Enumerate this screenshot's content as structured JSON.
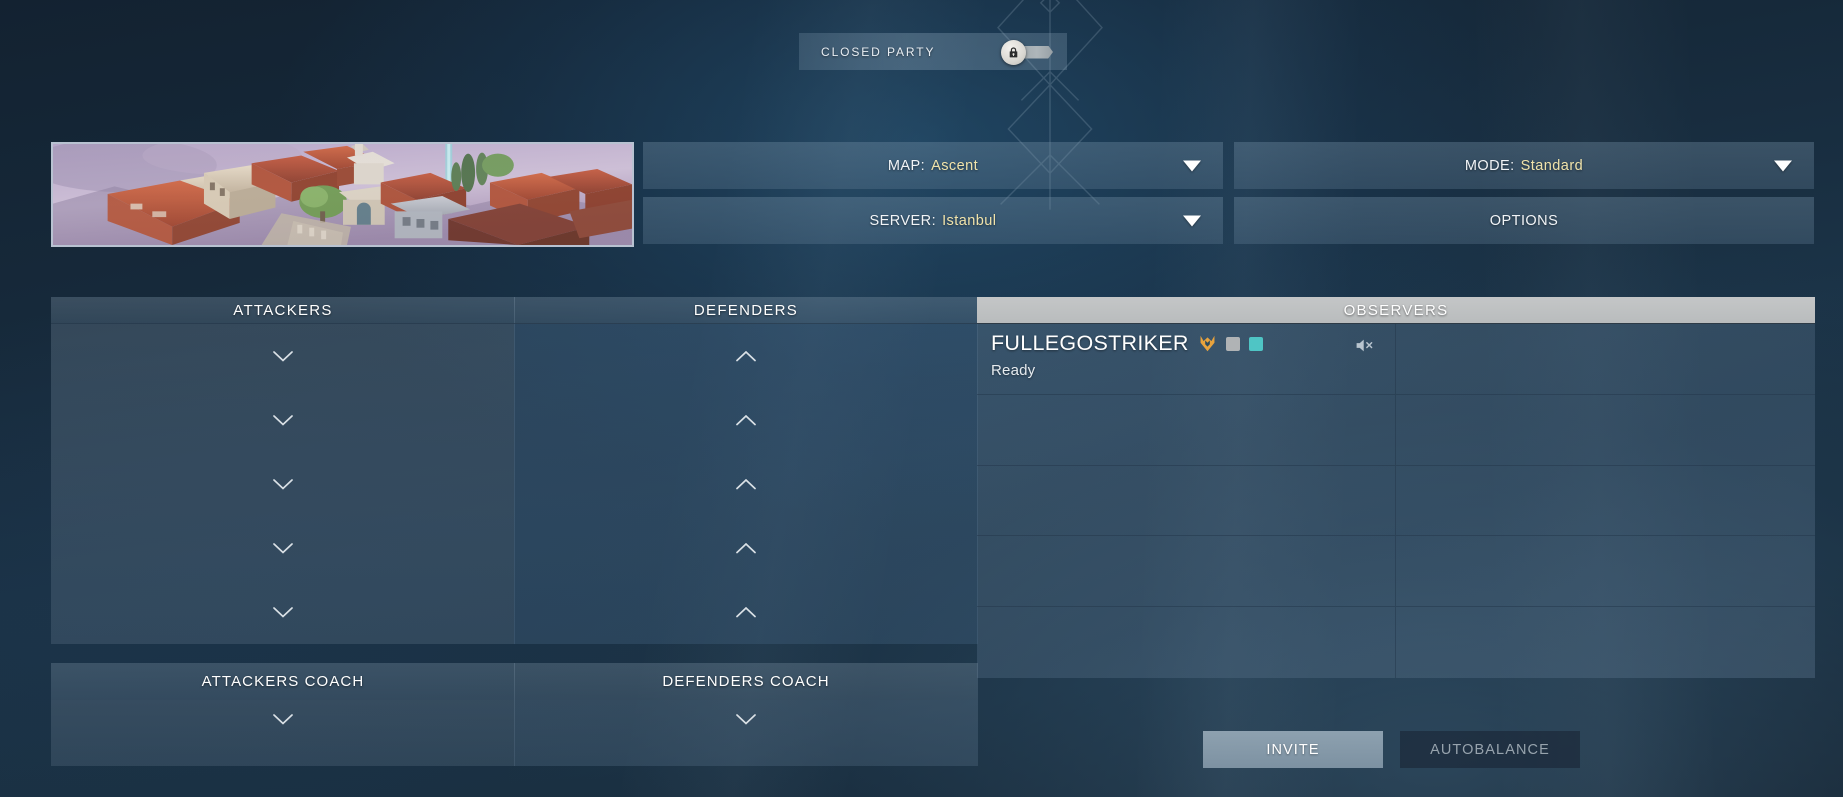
{
  "party": {
    "label": "CLOSED PARTY",
    "toggle_state": "closed",
    "lock_icon": "lock-icon"
  },
  "selectors": {
    "map": {
      "label": "MAP:",
      "value": "Ascent",
      "caret_icon": "caret-down-icon"
    },
    "server": {
      "label": "SERVER:",
      "value": "Istanbul",
      "caret_icon": "caret-down-icon"
    },
    "mode": {
      "label": "MODE:",
      "value": "Standard",
      "caret_icon": "caret-down-icon"
    },
    "options": {
      "label": "OPTIONS"
    }
  },
  "map_preview": {
    "name": "Ascent",
    "alt": "Aerial view of an Italian town with terracotta rooftops under a lavender sky"
  },
  "teams": {
    "attackers": {
      "header": "ATTACKERS",
      "slot_count": 5,
      "slot_icon": "chevron-down-icon",
      "coach_header": "ATTACKERS COACH",
      "coach_icon": "chevron-down-icon"
    },
    "defenders": {
      "header": "DEFENDERS",
      "slot_count": 5,
      "slot_icon": "chevron-up-icon",
      "coach_header": "DEFENDERS COACH",
      "coach_icon": "chevron-down-icon"
    }
  },
  "observers": {
    "header": "OBSERVERS",
    "rows": 5,
    "columns": 2,
    "players": [
      {
        "name": "FULLEGOSTRIKER",
        "status": "Ready",
        "rank_icon": "agent-badge-icon",
        "chips": [
          "gray",
          "teal"
        ],
        "audio_icon": "speaker-muted-icon"
      }
    ]
  },
  "actions": {
    "invite": {
      "label": "INVITE",
      "enabled": true
    },
    "autobalance": {
      "label": "AUTOBALANCE",
      "enabled": false
    }
  },
  "colors": {
    "background_dark": "#101d2b",
    "panel_blue": "#5a7288",
    "accent_cream": "#f0e3ab",
    "observers_header": "#c4c6c7",
    "chip_teal": "#4fc5c5",
    "chip_gray": "#b0b3b5",
    "rank_orange": "#e8a33d"
  }
}
